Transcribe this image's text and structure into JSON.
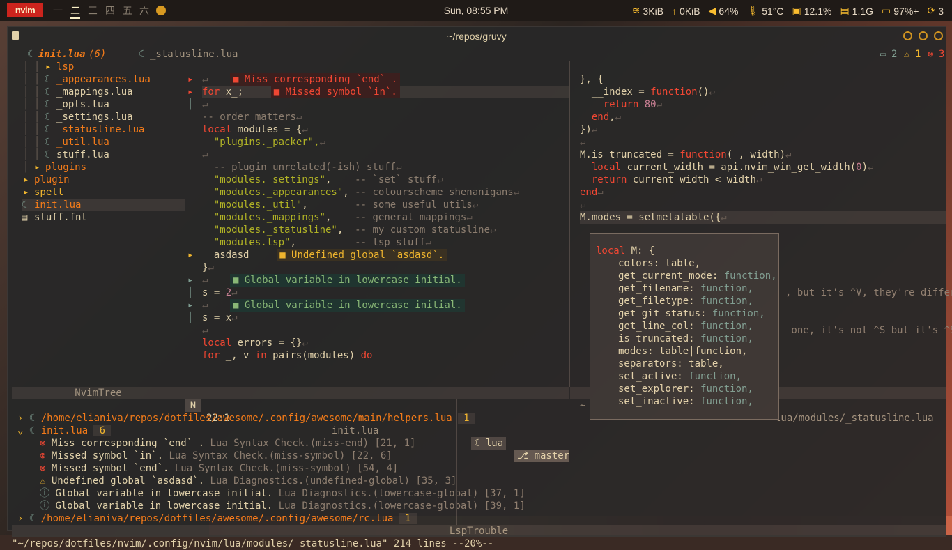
{
  "topbar": {
    "logo": "nvim",
    "workspaces": [
      "一",
      "二",
      "三",
      "四",
      "五",
      "六"
    ],
    "active_workspace_index": 1,
    "clock": "Sun, 08:55 PM",
    "stats": [
      {
        "icon": "wifi-icon",
        "glyph": "≋",
        "label": "3KiB"
      },
      {
        "icon": "upload-icon",
        "glyph": "↑",
        "label": "0KiB"
      },
      {
        "icon": "volume-icon",
        "glyph": "◀",
        "label": "64%"
      },
      {
        "icon": "thermometer-icon",
        "glyph": "🌡",
        "label": "51°C"
      },
      {
        "icon": "cpu-icon",
        "glyph": "▣",
        "label": "12.1%"
      },
      {
        "icon": "memory-icon",
        "glyph": "▤",
        "label": "1.1G"
      },
      {
        "icon": "battery-icon",
        "glyph": "▭",
        "label": "97%+"
      },
      {
        "icon": "updates-icon",
        "glyph": "⟳",
        "label": "3"
      }
    ]
  },
  "window": {
    "title": "~/repos/gruvy"
  },
  "tabs": {
    "active": "init.lua",
    "active_count": "(6)",
    "second": "_statusline.lua",
    "diag_hint": "2",
    "diag_warn": "1",
    "diag_err": "3"
  },
  "tree": [
    {
      "indent": 3,
      "arrow": "▸",
      "icon": "",
      "text": "lsp",
      "cls": "org"
    },
    {
      "indent": 3,
      "arrow": "",
      "icon": "☾",
      "text": "_appearances.lua",
      "cls": "org"
    },
    {
      "indent": 3,
      "arrow": "",
      "icon": "☾",
      "text": "_mappings.lua",
      "cls": "fg"
    },
    {
      "indent": 3,
      "arrow": "",
      "icon": "☾",
      "text": "_opts.lua",
      "cls": "fg"
    },
    {
      "indent": 3,
      "arrow": "",
      "icon": "☾",
      "text": "_settings.lua",
      "cls": "fg"
    },
    {
      "indent": 3,
      "arrow": "",
      "icon": "☾",
      "text": "_statusline.lua",
      "cls": "org"
    },
    {
      "indent": 3,
      "arrow": "",
      "icon": "☾",
      "text": "_util.lua",
      "cls": "org"
    },
    {
      "indent": 3,
      "arrow": "",
      "icon": "☾",
      "text": "stuff.lua",
      "cls": "fg"
    },
    {
      "indent": 2,
      "arrow": "▸",
      "icon": "",
      "text": "plugins",
      "cls": "org"
    },
    {
      "indent": 1,
      "arrow": "▸",
      "icon": "",
      "text": "plugin",
      "cls": "org"
    },
    {
      "indent": 1,
      "arrow": "▸",
      "icon": "",
      "text": "spell",
      "cls": "yel"
    },
    {
      "indent": 1,
      "arrow": "",
      "icon": "☾",
      "text": "init.lua",
      "cls": "org"
    },
    {
      "indent": 1,
      "arrow": "",
      "icon": "▤",
      "text": "stuff.fnl",
      "cls": "fg"
    }
  ],
  "editor_left": [
    {
      "g": "▸",
      "t": "↵",
      "diag": "■ Miss corresponding `end` .",
      "dcls": "err"
    },
    {
      "g": "▸",
      "t": "for x_;",
      "diag": "■ Missed symbol `in`.",
      "dcls": "err"
    },
    {
      "g": "│",
      "t": "↵"
    },
    {
      "g": "",
      "t": "-- order matters↵",
      "cls": "cm"
    },
    {
      "g": "",
      "t": "local modules = {↵"
    },
    {
      "g": "",
      "t": "  \"plugins._packer\",↵",
      "cls": "str"
    },
    {
      "g": "",
      "t": "↵"
    },
    {
      "g": "",
      "t": "  -- plugin unrelated(-ish) stuff↵",
      "cls": "cm"
    },
    {
      "g": "",
      "t": "  \"modules._settings\",    -- `set` stuff↵"
    },
    {
      "g": "",
      "t": "  \"modules._appearances\", -- colourscheme shenanigans↵"
    },
    {
      "g": "",
      "t": "  \"modules._util\",        -- some useful utils↵"
    },
    {
      "g": "",
      "t": "  \"modules._mappings\",    -- general mappings↵"
    },
    {
      "g": "",
      "t": "  \"modules._statusline\",  -- my custom statusline↵"
    },
    {
      "g": "",
      "t": "  \"modules.lsp\",          -- lsp stuff↵"
    },
    {
      "g": "▸",
      "t": "  asdasd",
      "diag": "■ Undefined global `asdasd`.",
      "dcls": "warn"
    },
    {
      "g": "",
      "t": "}↵"
    },
    {
      "g": "▸",
      "t": "↵",
      "diag": "■ Global variable in lowercase initial.",
      "dcls": "info"
    },
    {
      "g": "│",
      "t": "s = 2↵"
    },
    {
      "g": "▸",
      "t": "↵",
      "diag": "■ Global variable in lowercase initial.",
      "dcls": "info"
    },
    {
      "g": "│",
      "t": "s = x↵"
    },
    {
      "g": "",
      "t": "↵"
    },
    {
      "g": "",
      "t": "local errors = {}↵"
    },
    {
      "g": "",
      "t": "for _, v in pairs(modules) do"
    }
  ],
  "editor_right": [
    "}, {",
    "  __index = function()↵",
    "    return 80↵",
    "  end,↵",
    "})↵",
    "↵",
    "M.is_truncated = function(_, width)↵",
    "  local current_width = api.nvim_win_get_width(0)↵",
    "  return current_width < width↵",
    "end↵",
    "↵",
    "M.modes = setmetatable({↵"
  ],
  "right_fragments": {
    "line1": ", but it's ^V, they're differe",
    "line2": " one, it's not ^S but it's ^S"
  },
  "popup": {
    "header": "local M: {",
    "fields": [
      {
        "k": "colors",
        "v": "table,"
      },
      {
        "k": "get_current_mode",
        "v": "function,"
      },
      {
        "k": "get_filename",
        "v": "function,"
      },
      {
        "k": "get_filetype",
        "v": "function,"
      },
      {
        "k": "get_git_status",
        "v": "function,"
      },
      {
        "k": "get_line_col",
        "v": "function,"
      },
      {
        "k": "is_truncated",
        "v": "function,"
      },
      {
        "k": "modes",
        "v": "table|function,"
      },
      {
        "k": "separators",
        "v": "table,"
      },
      {
        "k": "set_active",
        "v": "function,"
      },
      {
        "k": "set_explorer",
        "v": "function,"
      },
      {
        "k": "set_inactive",
        "v": "function,"
      }
    ]
  },
  "statusline": {
    "tree": "NvimTree",
    "mode": "N",
    "pos": "22:1",
    "file": "init.lua",
    "ft": "lua",
    "branch": "master",
    "right_file": "lua/modules/_statusline.lua",
    "right_mark": "~"
  },
  "trouble": {
    "title": "LspTrouble",
    "groups": [
      {
        "arrow": "›",
        "file": "/home/elianiva/repos/dotfiles/awesome/.config/awesome/main/helpers.lua",
        "count": "1"
      },
      {
        "arrow": "⌄",
        "file": "init.lua",
        "count": "6"
      }
    ],
    "items": [
      {
        "icon": "error-icon",
        "glyph": "⊗",
        "msg": "Miss corresponding `end` .",
        "src": "Lua Syntax Check.(miss-end)",
        "pos": "[21, 1]",
        "cls": "red"
      },
      {
        "icon": "error-icon",
        "glyph": "⊗",
        "msg": "Missed symbol `in`.",
        "src": "Lua Syntax Check.(miss-symbol)",
        "pos": "[22, 6]",
        "cls": "red"
      },
      {
        "icon": "error-icon",
        "glyph": "⊗",
        "msg": "Missed symbol `end`.",
        "src": "Lua Syntax Check.(miss-symbol)",
        "pos": "[54, 4]",
        "cls": "red"
      },
      {
        "icon": "warning-icon",
        "glyph": "⚠",
        "msg": "Undefined global `asdasd`.",
        "src": "Lua Diagnostics.(undefined-global)",
        "pos": "[35, 3]",
        "cls": "yel"
      },
      {
        "icon": "info-icon",
        "glyph": "ⓘ",
        "msg": "Global variable in lowercase initial.",
        "src": "Lua Diagnostics.(lowercase-global)",
        "pos": "[37, 1]",
        "cls": "blu"
      },
      {
        "icon": "info-icon",
        "glyph": "ⓘ",
        "msg": "Global variable in lowercase initial.",
        "src": "Lua Diagnostics.(lowercase-global)",
        "pos": "[39, 1]",
        "cls": "blu"
      }
    ],
    "last_group": {
      "arrow": "›",
      "file": "/home/elianiva/repos/dotfiles/awesome/.config/awesome/rc.lua",
      "count": "1"
    }
  },
  "cmdline": "\"~/repos/dotfiles/nvim/.config/nvim/lua/modules/_statusline.lua\" 214 lines --20%--"
}
